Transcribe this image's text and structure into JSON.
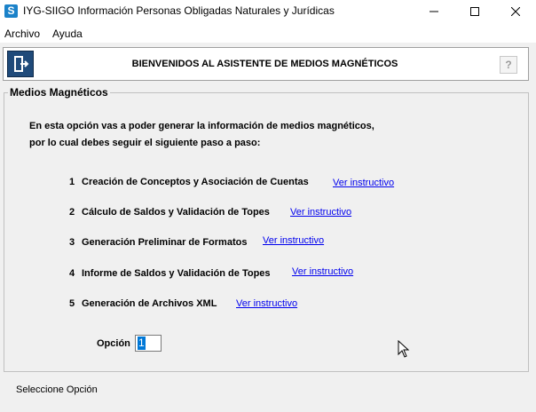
{
  "window": {
    "app_icon_letter": "S",
    "title": "IYG-SIIGO Información Personas Obligadas Naturales y Jurídicas"
  },
  "menu": {
    "items": [
      "Archivo",
      "Ayuda"
    ]
  },
  "header": {
    "title": "BIENVENIDOS AL ASISTENTE DE MEDIOS MAGNÉTICOS",
    "help_label": "?",
    "exit_icon": "exit-door-icon"
  },
  "group": {
    "title": "Medios Magnéticos",
    "intro_line1": "En esta opción vas a poder generar la información de medios magnéticos,",
    "intro_line2": "por lo cual debes seguir el siguiente paso a paso:",
    "steps": [
      {
        "num": "1",
        "label": "Creación  de Conceptos y Asociación de Cuentas",
        "link": "Ver instructivo"
      },
      {
        "num": "2",
        "label": "Cálculo de Saldos y Validación de Topes",
        "link": "Ver instructivo"
      },
      {
        "num": "3",
        "label": "Generación Preliminar de Formatos",
        "link": "Ver instructivo"
      },
      {
        "num": "4",
        "label": "Informe de Saldos y Validación de Topes",
        "link": "Ver instructivo"
      },
      {
        "num": "5",
        "label": "Generación de Archivos XML",
        "link": "Ver instructivo"
      }
    ],
    "option_label": "Opción",
    "option_value": "1"
  },
  "status": {
    "text": "Seleccione Opción"
  },
  "colors": {
    "link": "#0000ee",
    "selection": "#0078d7",
    "exit_button": "#1f4a7a"
  }
}
